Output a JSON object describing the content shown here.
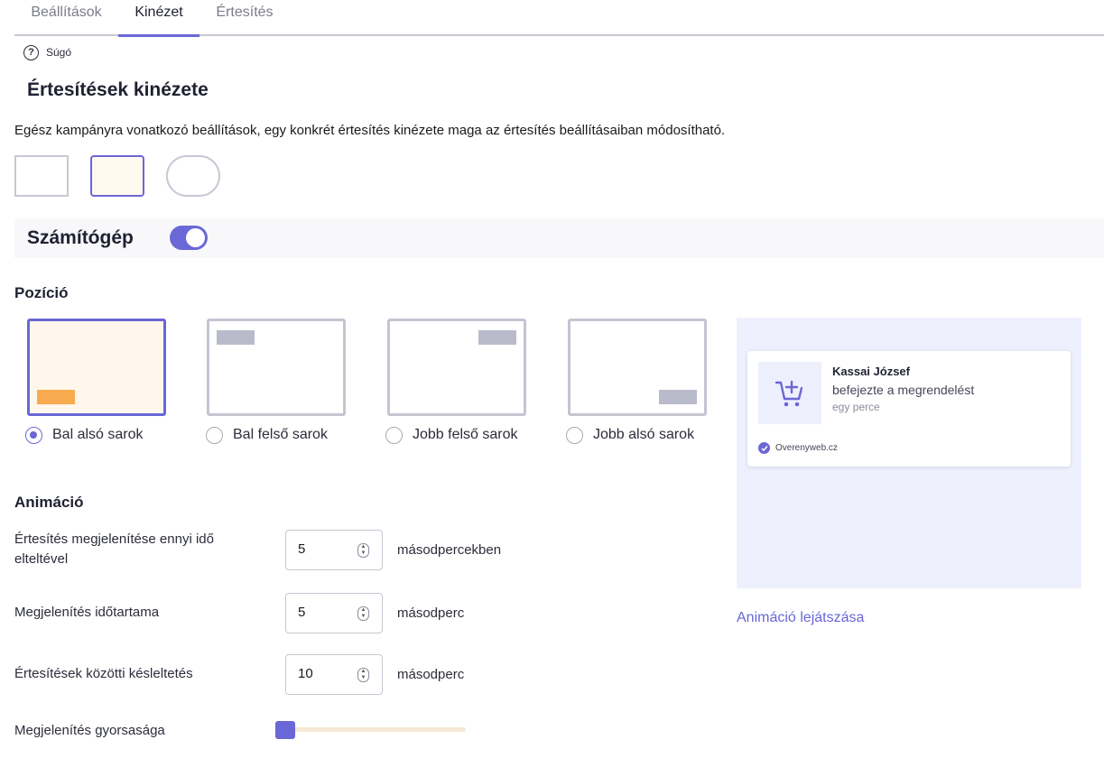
{
  "tabs": [
    {
      "label": "Beállítások"
    },
    {
      "label": "Kinézet"
    },
    {
      "label": "Értesítés"
    }
  ],
  "help": {
    "icon": "?",
    "label": "Súgó"
  },
  "section": {
    "title": "Értesítések kinézete",
    "description": "Egész kampányra vonatkozó beállítások, egy konkrét értesítés kinézete maga az értesítés beállításaiban módosítható."
  },
  "device": {
    "label": "Számítógép",
    "enabled": true
  },
  "position": {
    "title": "Pozíció",
    "options": [
      {
        "label": "Bal alsó sarok",
        "selected": true
      },
      {
        "label": "Bal felső sarok",
        "selected": false
      },
      {
        "label": "Jobb felső sarok",
        "selected": false
      },
      {
        "label": "Jobb alsó sarok",
        "selected": false
      }
    ]
  },
  "animation": {
    "title": "Animáció",
    "fields": [
      {
        "label": "Értesítés megjelenítése ennyi idő elteltével",
        "value": "5",
        "unit": "másodpercekben"
      },
      {
        "label": "Megjelenítés időtartama",
        "value": "5",
        "unit": "másodperc"
      },
      {
        "label": "Értesítések közötti késleltetés",
        "value": "10",
        "unit": "másodperc"
      }
    ],
    "speed": {
      "label": "Megjelenítés gyorsasága",
      "value_fraction": 0
    }
  },
  "preview": {
    "name": "Kassai József",
    "message": "befejezte a megrendelést",
    "time": "egy perce",
    "verified_by": "Overenyweb.cz",
    "play_label": "Animáció lejátszása"
  },
  "colors": {
    "accent": "#6a67d6",
    "selected_bg": "#fff6ec",
    "marker_selected": "#f8aa4f",
    "preview_bg": "#eff0fd"
  }
}
